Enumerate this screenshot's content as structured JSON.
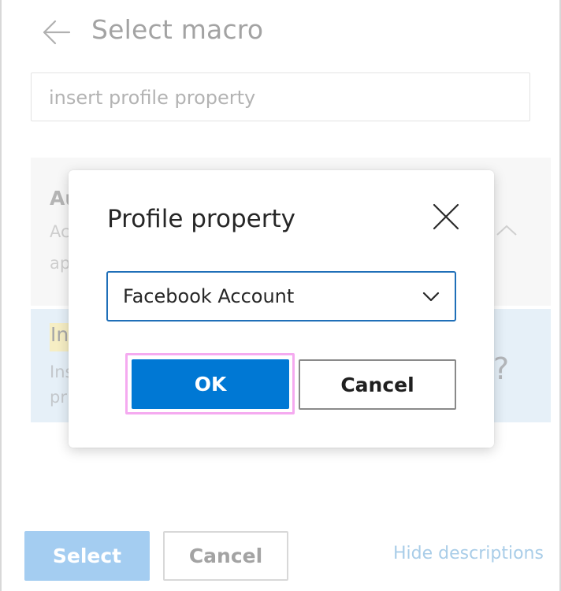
{
  "panel": {
    "title": "Select macro",
    "search_value": "insert profile property",
    "items": [
      {
        "title_fragment": "Au",
        "desc_fragment_1": "Ac",
        "desc_fragment_2": "ap"
      },
      {
        "title_fragment": "In",
        "desc_fragment_1": "Ins",
        "desc_fragment_2": "pr",
        "help_glyph": "?"
      }
    ],
    "footer": {
      "select_label": "Select",
      "cancel_label": "Cancel",
      "hide_descriptions_label": "Hide descriptions"
    }
  },
  "dialog": {
    "title": "Profile property",
    "selected_property": "Facebook Account",
    "ok_label": "OK",
    "cancel_label": "Cancel"
  },
  "icons": {
    "back": "arrow-left-icon",
    "close": "close-icon",
    "dropdown": "chevron-down-icon",
    "collapse": "chevron-up-icon"
  },
  "colors": {
    "primary": "#0078d4",
    "primary_disabled": "#a4cdf1",
    "focus_ring": "#f5aaf0",
    "selected_item_bg": "#e6f0f8",
    "highlight": "#f6eec4"
  }
}
